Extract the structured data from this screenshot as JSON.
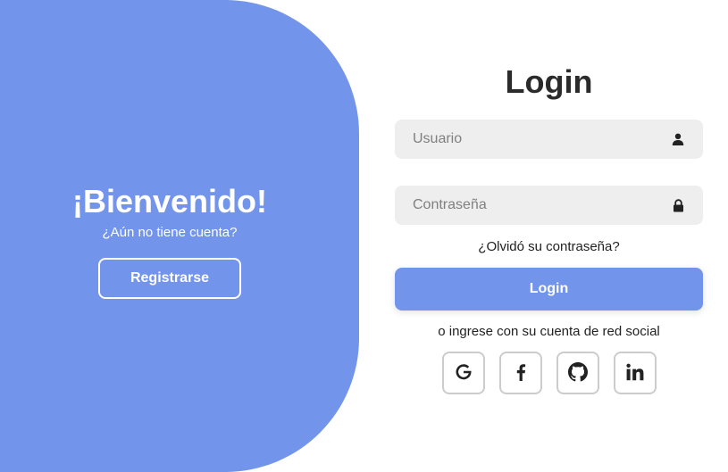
{
  "welcome": {
    "title": "¡Bienvenido!",
    "subtitle": "¿Aún no tiene cuenta?",
    "register_label": "Registrarse"
  },
  "login": {
    "title": "Login",
    "username": {
      "placeholder": "Usuario",
      "value": "",
      "icon": "user-icon"
    },
    "password": {
      "placeholder": "Contraseña",
      "value": "",
      "icon": "lock-icon"
    },
    "forgot_label": "¿Olvidó su contraseña?",
    "submit_label": "Login",
    "social_text": "o ingrese con su cuenta de red social",
    "social": [
      {
        "name": "Google",
        "icon": "google-icon"
      },
      {
        "name": "Facebook",
        "icon": "facebook-icon"
      },
      {
        "name": "GitHub",
        "icon": "github-icon"
      },
      {
        "name": "LinkedIn",
        "icon": "linkedin-icon"
      }
    ]
  },
  "colors": {
    "accent": "#7294eb",
    "input_bg": "#eeeeee",
    "text_dark": "#2b2b2b"
  }
}
